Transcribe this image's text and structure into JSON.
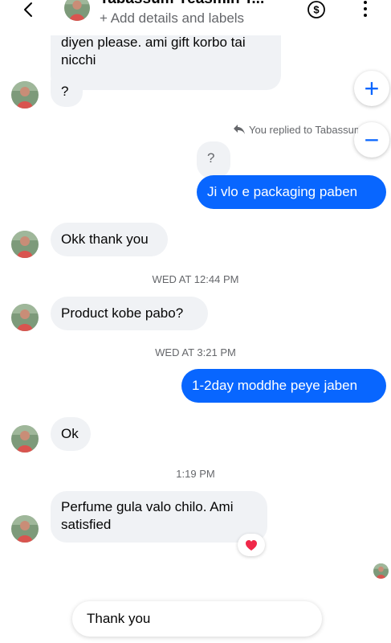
{
  "header": {
    "contact_name": "Tabassum Yeasmin T...",
    "subtitle": "+ Add details and labels"
  },
  "messages": {
    "m1_line1": "diyen please. ami gift korbo tai",
    "m1_line2": "nicchi",
    "m2": "?",
    "reply_note": "You replied to Tabassum",
    "quoted": "?",
    "m3": "Ji vlo e packaging paben",
    "m4": "Okk thank you",
    "ts1": "WED AT 12:44 PM",
    "m5": "Product kobe pabo?",
    "ts2": "WED AT 3:21 PM",
    "m6": "1-2day moddhe peye jaben",
    "m7": "Ok",
    "ts3": "1:19 PM",
    "m8_line1": "Perfume gula valo chilo. Ami",
    "m8_line2": "satisfied"
  },
  "reaction": {
    "emoji_icon": "heart-icon",
    "color": "#f02849"
  },
  "fabs": {
    "zoom_in": "+",
    "zoom_out": "−"
  },
  "quick_reply": {
    "text": "Thank you"
  },
  "colors": {
    "outgoing": "#0866ff",
    "incoming": "#f0f2f5",
    "accent": "#0866ff"
  }
}
